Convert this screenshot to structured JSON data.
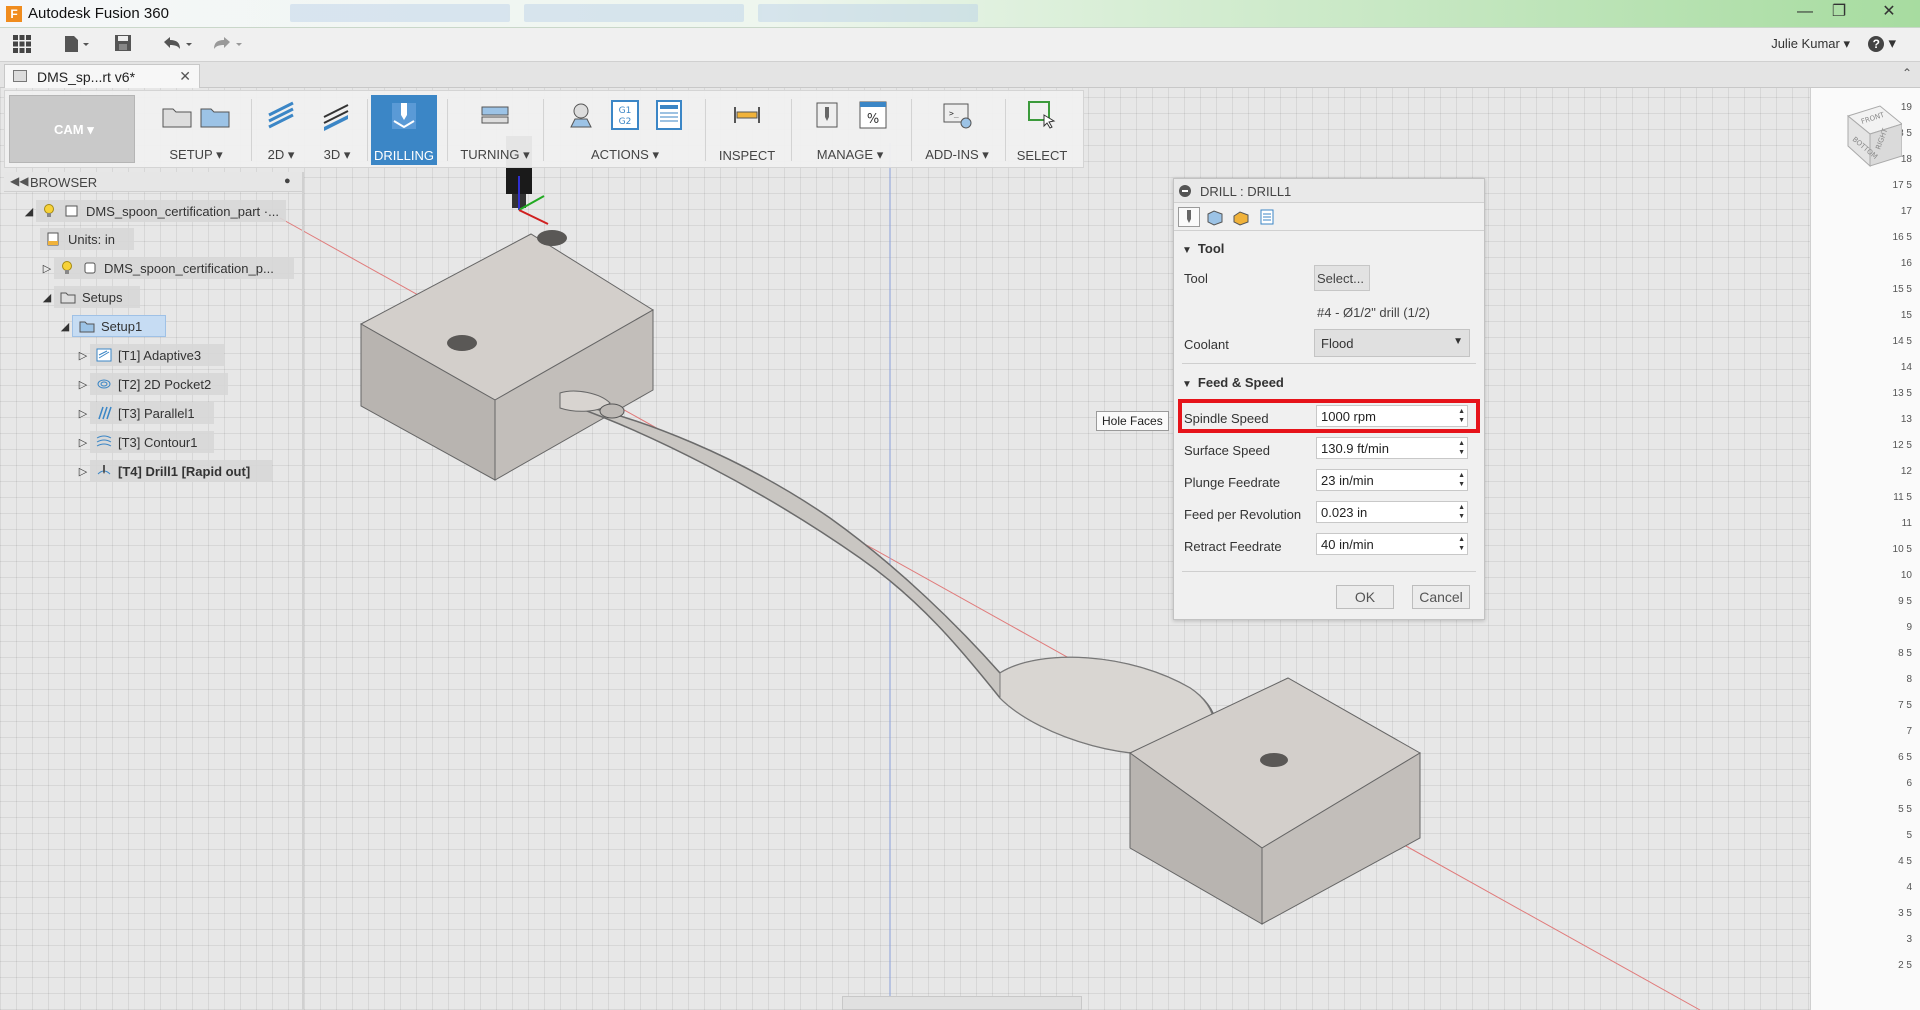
{
  "app": {
    "title": "Autodesk Fusion 360",
    "icon": "fusion-logo-icon"
  },
  "quick_access": {
    "user": "Julie Kumar",
    "help": "?"
  },
  "document_tab": {
    "label": "DMS_sp...rt v6*"
  },
  "ribbon": {
    "workspace": "CAM",
    "groups": [
      {
        "label": "SETUP"
      },
      {
        "label": "2D"
      },
      {
        "label": "3D"
      },
      {
        "label": "DRILLING"
      },
      {
        "label": "TURNING"
      },
      {
        "label": "ACTIONS"
      },
      {
        "label": "INSPECT"
      },
      {
        "label": "MANAGE"
      },
      {
        "label": "ADD-INS"
      },
      {
        "label": "SELECT"
      }
    ],
    "actions_icon_text": "G1\nG2",
    "manage_icon_text": "%"
  },
  "browser": {
    "title": "BROWSER",
    "items": [
      {
        "label": "DMS_spoon_certification_part ·..."
      },
      {
        "label": "Units: in"
      },
      {
        "label": "DMS_spoon_certification_p..."
      },
      {
        "label": "Setups"
      },
      {
        "label": "Setup1"
      },
      {
        "label": "[T1] Adaptive3"
      },
      {
        "label": "[T2] 2D Pocket2"
      },
      {
        "label": "[T3] Parallel1"
      },
      {
        "label": "[T3] Contour1"
      },
      {
        "label": "[T4] Drill1 [Rapid out]"
      }
    ]
  },
  "tooltip": "Hole Faces",
  "dialog": {
    "title": "DRILL : DRILL1",
    "tool_section": "Tool",
    "tool_label": "Tool",
    "tool_button": "Select...",
    "tool_info": "#4 - Ø1/2\" drill (1/2)",
    "coolant_label": "Coolant",
    "coolant_value": "Flood",
    "feed_section": "Feed & Speed",
    "fields": [
      {
        "label": "Spindle Speed",
        "value": "1000 rpm"
      },
      {
        "label": "Surface Speed",
        "value": "130.9 ft/min"
      },
      {
        "label": "Plunge Feedrate",
        "value": "23 in/min"
      },
      {
        "label": "Feed per Revolution",
        "value": "0.023 in"
      },
      {
        "label": "Retract Feedrate",
        "value": "40 in/min"
      }
    ],
    "ok": "OK",
    "cancel": "Cancel",
    "highlight_color": "#e6131a"
  },
  "ruler": {
    "ticks": [
      "19",
      "18 5",
      "18",
      "17 5",
      "17",
      "16 5",
      "16",
      "15 5",
      "15",
      "14 5",
      "14",
      "13 5",
      "13",
      "12 5",
      "12",
      "11 5",
      "11",
      "10 5",
      "10",
      "9 5",
      "9",
      "8 5",
      "8",
      "7 5",
      "7",
      "6 5",
      "6",
      "5 5",
      "5",
      "4 5",
      "4",
      "3 5",
      "3",
      "2 5"
    ]
  },
  "viewcube": {
    "front": "FRONT",
    "right": "RIGHT",
    "bottom": "BOTTOM"
  },
  "colors": {
    "accent": "#3b86c6",
    "red_axis": "#e0303a"
  }
}
